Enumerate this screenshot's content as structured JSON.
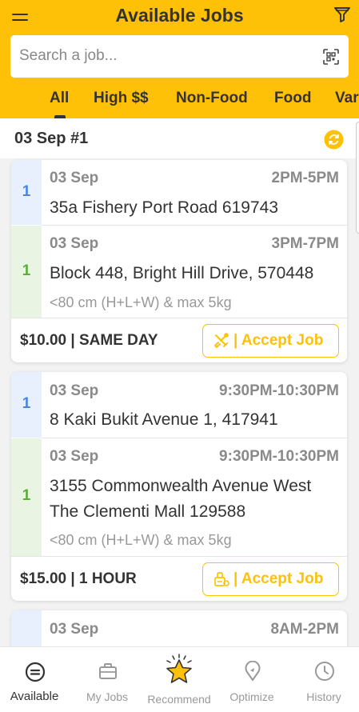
{
  "header": {
    "title": "Available Jobs",
    "search_placeholder": "Search a job...",
    "accent_color": "#FFC107"
  },
  "tabs": [
    {
      "label": "All",
      "active": true
    },
    {
      "label": "High $$"
    },
    {
      "label": "Non-Food"
    },
    {
      "label": "Food"
    },
    {
      "label": "Var"
    }
  ],
  "group": {
    "title": "03 Sep #1"
  },
  "jobs": [
    {
      "pickup": {
        "count": "1",
        "date": "03 Sep",
        "time": "2PM-5PM",
        "address": "35a Fishery Port Road 619743"
      },
      "dropoff": {
        "count": "1",
        "date": "03 Sep",
        "time": "3PM-7PM",
        "address": "Block 448, Bright Hill Drive, 570448",
        "size": "<80 cm (H+L+W) & max 5kg"
      },
      "price": "$10.00 | SAME DAY",
      "accept_label": "| Accept Job",
      "accept_icon": "tools-icon"
    },
    {
      "pickup": {
        "count": "1",
        "date": "03 Sep",
        "time": "9:30PM-10:30PM",
        "address": "8 Kaki Bukit Avenue 1, 417941"
      },
      "dropoff": {
        "count": "1",
        "date": "03 Sep",
        "time": "9:30PM-10:30PM",
        "address_line1": "3155 Commonwealth Avenue West",
        "address_line2": "The Clementi Mall 129588",
        "size": "<80 cm (H+L+W) & max 5kg"
      },
      "price": "$15.00 | 1 HOUR",
      "accept_label": "| Accept Job",
      "accept_icon": "food-delivery-icon"
    },
    {
      "pickup": {
        "date": "03 Sep",
        "time": "8AM-2PM"
      }
    }
  ],
  "nav": [
    {
      "label": "Available",
      "icon": "available-icon",
      "active": true
    },
    {
      "label": "My Jobs",
      "icon": "briefcase-icon"
    },
    {
      "label": "Recommend",
      "icon": "star-icon"
    },
    {
      "label": "Optimize",
      "icon": "location-pin-icon"
    },
    {
      "label": "History",
      "icon": "clock-icon"
    }
  ]
}
